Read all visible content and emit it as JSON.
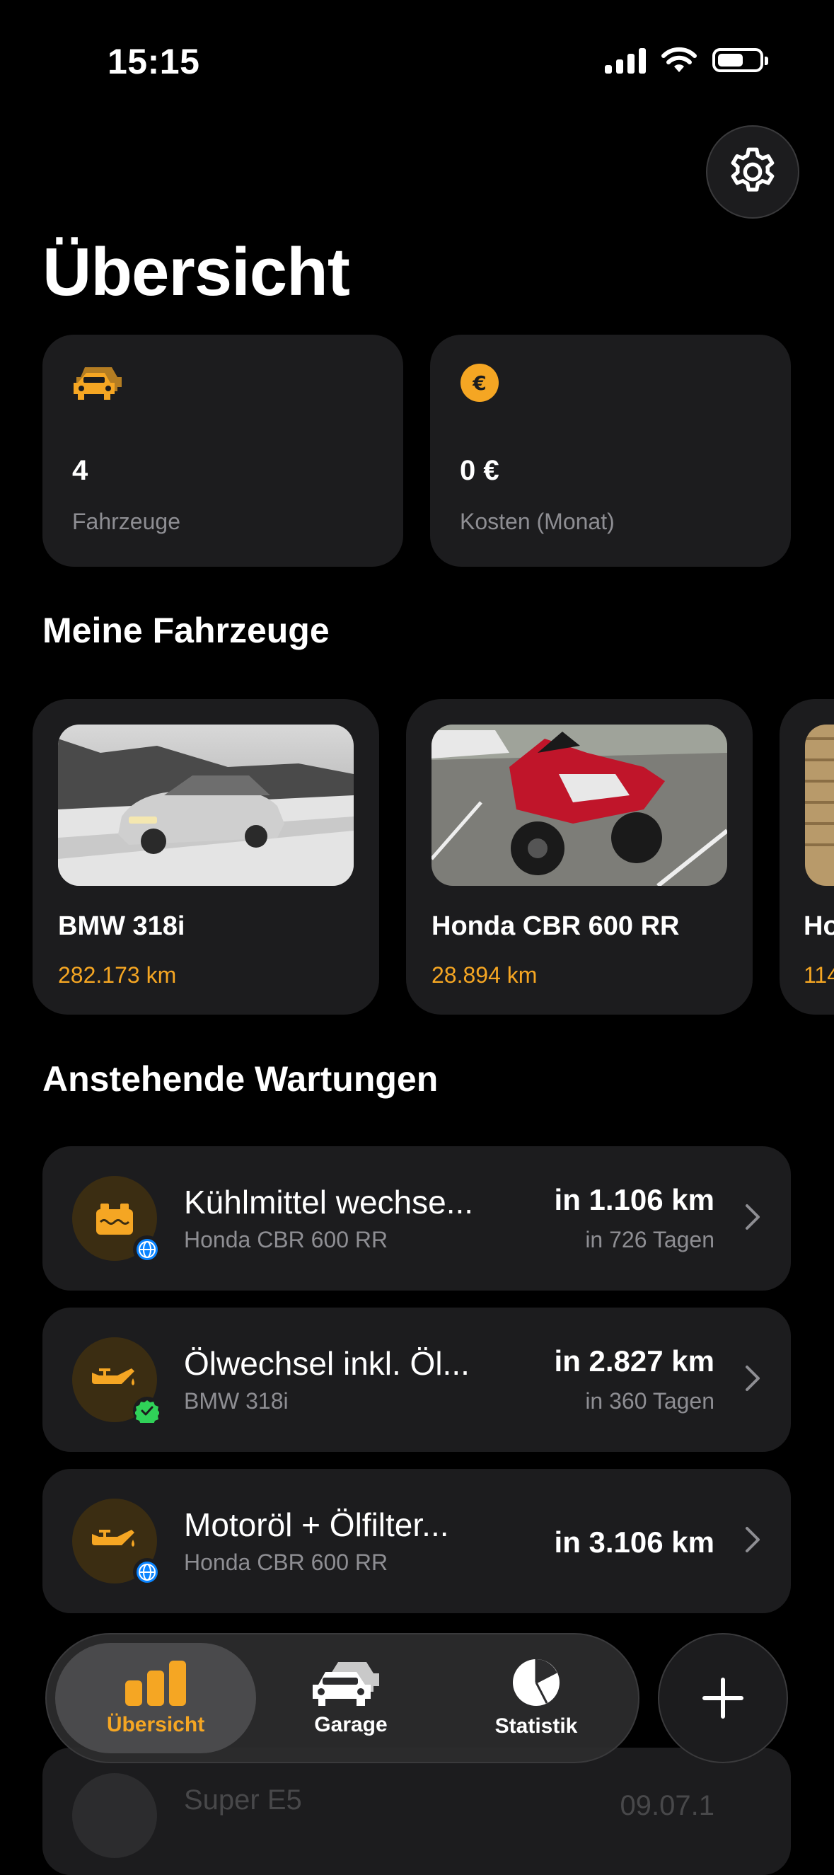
{
  "status_bar": {
    "time": "15:15"
  },
  "header": {
    "title": "Übersicht"
  },
  "stats": [
    {
      "icon": "cars-icon",
      "value": "4",
      "label": "Fahrzeuge"
    },
    {
      "icon": "euro-icon",
      "value": "0 €",
      "label": "Kosten (Monat)"
    }
  ],
  "vehicles_section": {
    "title": "Meine Fahrzeuge",
    "items": [
      {
        "name": "BMW 318i",
        "km": "282.173 km"
      },
      {
        "name": "Honda CBR 600 RR",
        "km": "28.894 km"
      },
      {
        "name": "Ho",
        "km": "114"
      }
    ]
  },
  "maintenance_section": {
    "title": "Anstehende Wartungen",
    "items": [
      {
        "icon": "coolant-icon",
        "badge": "globe-badge-icon",
        "title": "Kühlmittel wechse...",
        "vehicle": "Honda CBR 600 RR",
        "distance": "in 1.106 km",
        "days": "in 726 Tagen"
      },
      {
        "icon": "oil-can-icon",
        "badge": "check-badge-icon",
        "title": "Ölwechsel inkl. Öl...",
        "vehicle": "BMW 318i",
        "distance": "in 2.827 km",
        "days": "in 360 Tagen"
      },
      {
        "icon": "oil-can-icon",
        "badge": "globe-badge-icon",
        "title": "Motoröl + Ölfilter...",
        "vehicle": "Honda CBR 600 RR",
        "distance": "in 3.106 km",
        "days": ""
      }
    ]
  },
  "peek_item": {
    "title": "Super E5",
    "right": "09.07.1"
  },
  "tabbar": {
    "tabs": [
      {
        "label": "Übersicht",
        "icon": "chart-bars-icon",
        "active": true
      },
      {
        "label": "Garage",
        "icon": "garage-cars-icon",
        "active": false
      },
      {
        "label": "Statistik",
        "icon": "pie-chart-icon",
        "active": false
      }
    ]
  },
  "colors": {
    "accent": "#F5A623",
    "background": "#000000",
    "card": "#1C1C1E",
    "secondary_text": "#8E8E93"
  }
}
